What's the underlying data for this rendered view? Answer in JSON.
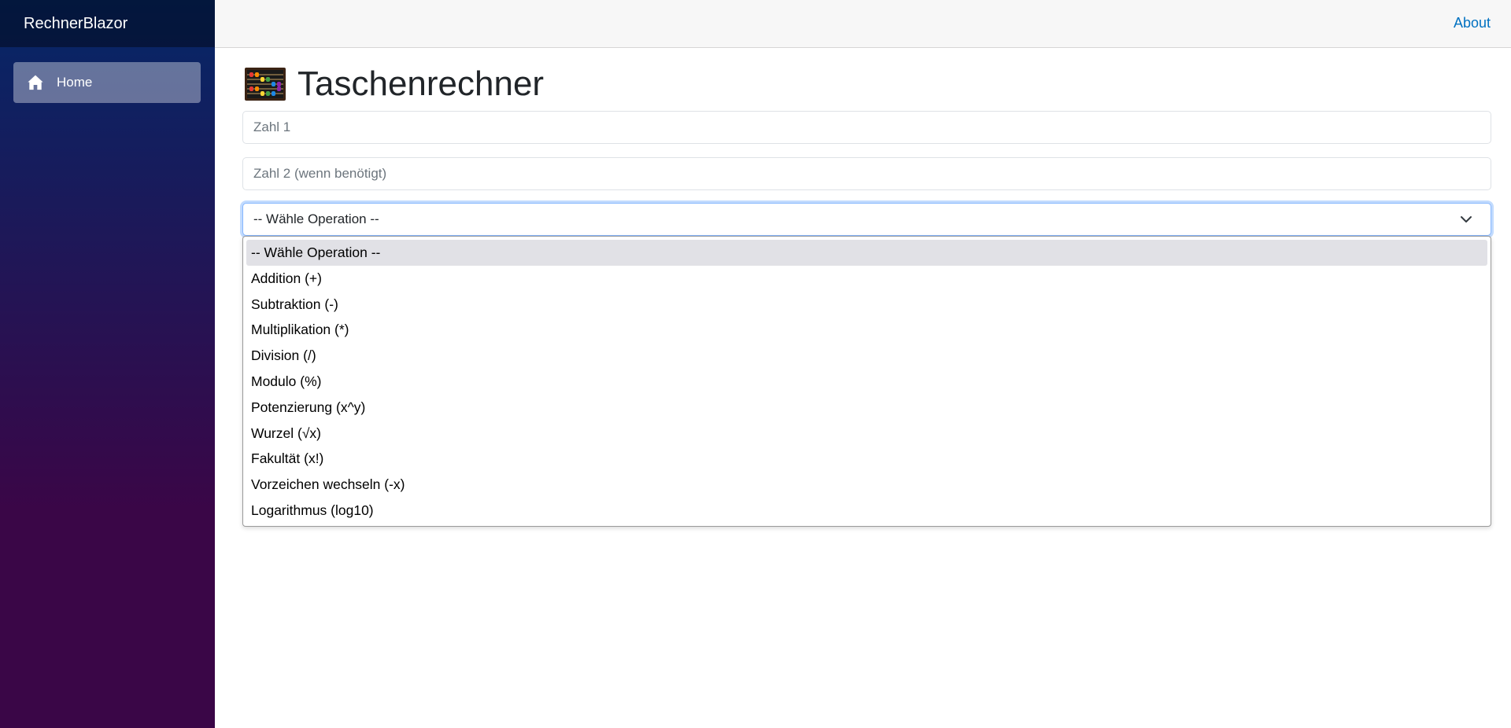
{
  "sidebar": {
    "brand": "RechnerBlazor",
    "items": [
      {
        "label": "Home",
        "icon": "home-icon"
      }
    ]
  },
  "topbar": {
    "about_label": "About"
  },
  "main": {
    "title": "Taschenrechner",
    "title_icon": "abacus-icon",
    "zahl1_placeholder": "Zahl 1",
    "zahl2_placeholder": "Zahl 2 (wenn benötigt)",
    "operation_selected": "-- Wähle Operation --",
    "operation_options": [
      "-- Wähle Operation --",
      "Addition (+)",
      "Subtraktion (-)",
      "Multiplikation (*)",
      "Division (/)",
      "Modulo (%)",
      "Potenzierung (x^y)",
      "Wurzel (√x)",
      "Fakultät (x!)",
      "Vorzeichen wechseln (-x)",
      "Logarithmus (log10)"
    ]
  },
  "colors": {
    "sidebar_top": "#052767",
    "sidebar_bottom": "#3a0647",
    "link": "#0071c1",
    "focus_border": "#86b7fe",
    "option_highlight": "#e1e1e6"
  }
}
